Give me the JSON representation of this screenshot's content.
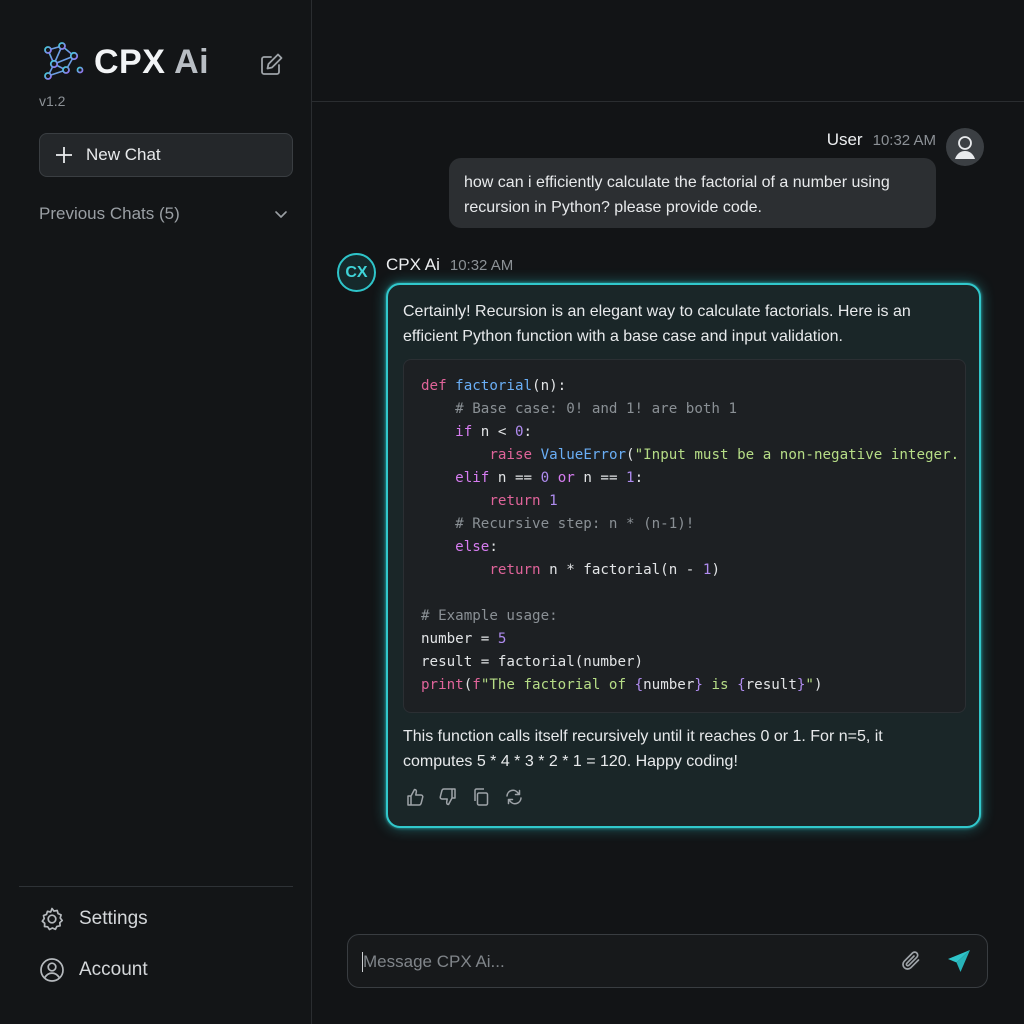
{
  "sidebar": {
    "brand_name": "CPX",
    "brand_suffix": "Ai",
    "version": "v1.2",
    "new_chat_label": "New Chat",
    "previous_chats_label": "Previous Chats (5)",
    "settings_label": "Settings",
    "account_label": "Account"
  },
  "conversation": {
    "user": {
      "name": "User",
      "time": "10:32 AM",
      "message_line1": "how can i efficiently calculate the factorial of a number using",
      "message_line2": "recursion in Python? please provide code."
    },
    "bot": {
      "avatar_text": "CX",
      "name": "CPX Ai",
      "time": "10:32 AM",
      "intro_line1": "Certainly! Recursion is an elegant way to calculate factorials. Here is an",
      "intro_line2": "efficient Python function with a base case and input validation.",
      "outro_line1": "This function calls itself recursively until it reaches 0 or 1. For n=5, it",
      "outro_line2": "computes 5 * 4 * 3 * 2 * 1 = 120. Happy coding!"
    },
    "code_lines": [
      "def factorial(n):",
      "    # Base case: 0! and 1! are both 1",
      "    if n < 0:",
      "        raise ValueError(\"Input must be a non-negative integer.",
      "    elif n == 0 or n == 1:",
      "        return 1",
      "    # Recursive step: n * (n-1)!",
      "    else:",
      "        return n * factorial(n - 1)",
      "",
      "# Example usage:",
      "number = 5",
      "result = factorial(number)",
      "print(f\"The factorial of {number} is {result}\")"
    ]
  },
  "composer": {
    "placeholder": "Message CPX Ai..."
  },
  "colors": {
    "accent": "#31c8cc",
    "send": "#2ec4c9",
    "background": "#121416"
  }
}
